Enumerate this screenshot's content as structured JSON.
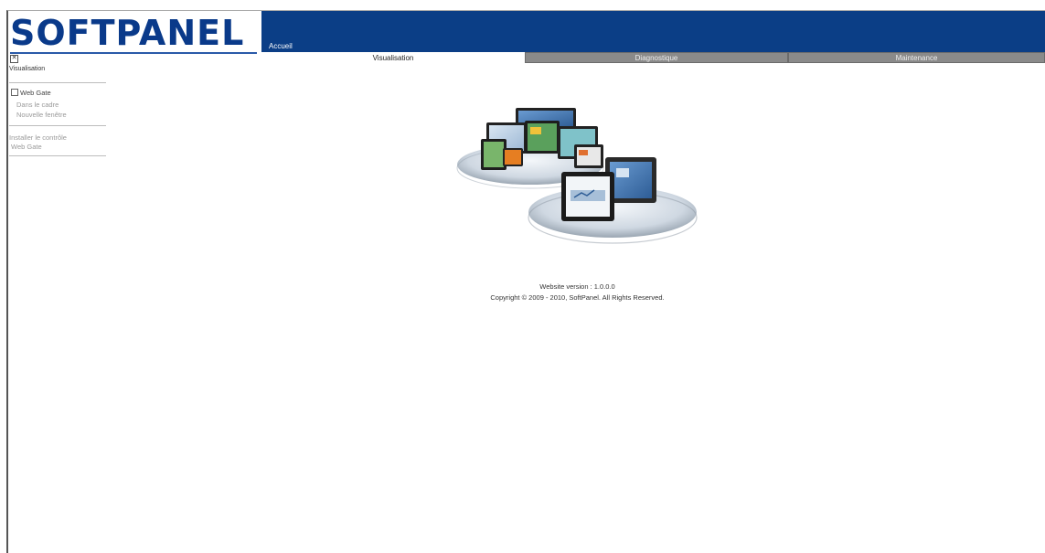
{
  "header": {
    "logo_text": "SOFTPANEL",
    "banner_label": "Accueil",
    "brand_color": "#0b3e86"
  },
  "tabs": [
    {
      "label": "Visualisation",
      "active": true
    },
    {
      "label": "Diagnostique",
      "active": false
    },
    {
      "label": "Maintenance",
      "active": false
    }
  ],
  "sidebar": {
    "close_icon": "close-icon",
    "title": "Visualisation",
    "web_gate": "Web Gate",
    "sub_items": [
      "Dans le cadre",
      "Nouvelle fenêtre"
    ],
    "install_label": "Installer le contrôle",
    "install_sub": "Web Gate"
  },
  "main": {
    "version": "Website version : 1.0.0.0",
    "copyright": "Copyright © 2009 - 2010, SoftPanel. All Rights Reserved."
  }
}
